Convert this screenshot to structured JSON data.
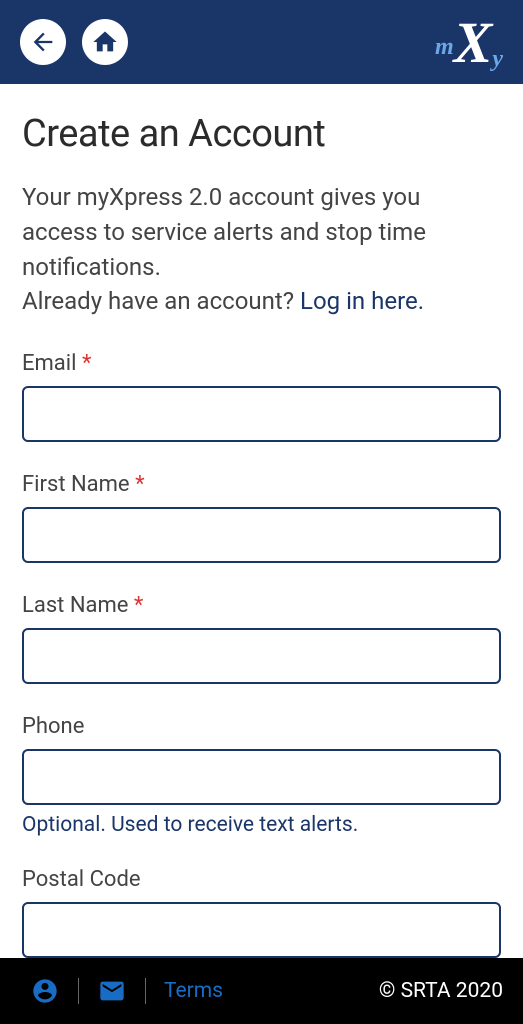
{
  "header": {
    "logo_m": "m",
    "logo_x": "X",
    "logo_y": "y"
  },
  "page": {
    "title": "Create an Account",
    "intro1": "Your myXpress 2.0 account gives you access to service alerts and stop time notifications.",
    "intro2": "Already have an account? ",
    "login_link": "Log in here."
  },
  "fields": {
    "email": {
      "label": "Email",
      "required": "*"
    },
    "firstName": {
      "label": "First Name",
      "required": "*"
    },
    "lastName": {
      "label": "Last Name",
      "required": "*"
    },
    "phone": {
      "label": "Phone",
      "hint": "Optional. Used to receive text alerts."
    },
    "postalCode": {
      "label": "Postal Code"
    }
  },
  "footer": {
    "terms": "Terms",
    "copyright": "© SRTA 2020"
  }
}
